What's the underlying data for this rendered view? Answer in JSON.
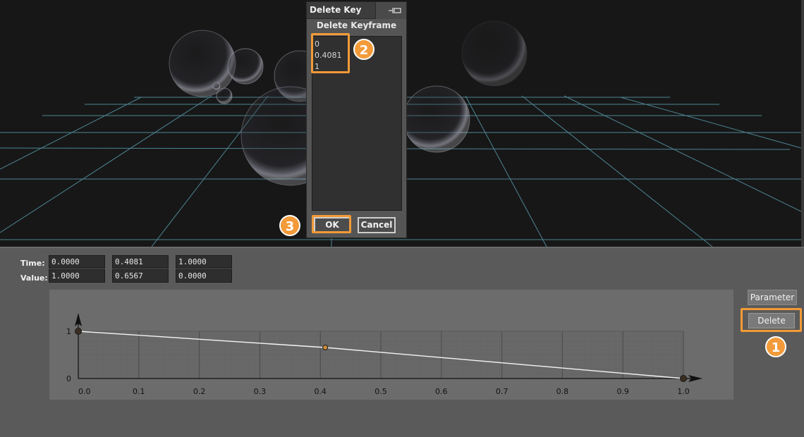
{
  "dialog": {
    "title": "Delete Key",
    "pin_icon": "pin-icon",
    "header": "Delete Keyframe",
    "keys": [
      "0",
      "0.4081",
      "1"
    ],
    "ok_label": "OK",
    "cancel_label": "Cancel"
  },
  "editor": {
    "time_label": "Time:",
    "value_label": "Value:",
    "times": [
      "0.0000",
      "0.4081",
      "1.0000"
    ],
    "values": [
      "1.0000",
      "0.6567",
      "0.0000"
    ]
  },
  "side_buttons": {
    "parameter_label": "Parameter",
    "delete_label": "Delete"
  },
  "annotations": {
    "step1": "1",
    "step2": "2",
    "step3": "3",
    "color": "#f29a37"
  },
  "curve": {
    "x_ticks": [
      "0.0",
      "0.1",
      "0.2",
      "0.3",
      "0.4",
      "0.5",
      "0.6",
      "0.7",
      "0.8",
      "0.9",
      "1.0"
    ],
    "y_ticks": [
      "1",
      "0"
    ],
    "keyframes": [
      {
        "time": 0.0,
        "value": 1.0
      },
      {
        "time": 0.4081,
        "value": 0.6567
      },
      {
        "time": 1.0,
        "value": 0.0
      }
    ]
  },
  "colors": {
    "grid": "#5fa9bd",
    "curve": "#f5f5f5",
    "accent": "#f29a37"
  }
}
